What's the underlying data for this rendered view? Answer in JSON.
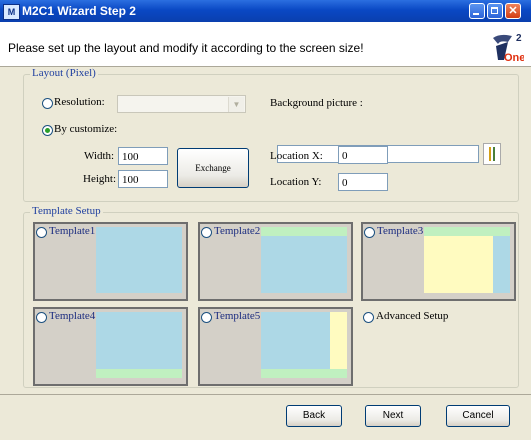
{
  "window": {
    "title": "M2C1 Wizard Step 2",
    "icon_text": "M",
    "close_glyph": "✕"
  },
  "header": {
    "instruction": "Please set up the layout and modify it according to the screen size!",
    "logo_number": "2",
    "logo_text": "One"
  },
  "layout": {
    "legend": "Layout (Pixel)",
    "resolution_label": "Resolution:",
    "resolution_value": "",
    "customize_label": "By customize:",
    "width_label": "Width:",
    "width_value": "100",
    "height_label": "Height:",
    "height_value": "100",
    "exchange_label": "Exchange",
    "background_label": "Background picture :",
    "background_value": "",
    "location_x_label": "Location X:",
    "location_x_value": "0",
    "location_y_label": "Location Y:",
    "location_y_value": "0",
    "selected_mode": "By customize"
  },
  "templates": {
    "legend": "Template Setup",
    "items": [
      {
        "label": "Template1"
      },
      {
        "label": "Template2"
      },
      {
        "label": "Template3"
      },
      {
        "label": "Template4"
      },
      {
        "label": "Template5"
      }
    ],
    "advanced_label": "Advanced Setup"
  },
  "buttons": {
    "back": "Back",
    "next": "Next",
    "cancel": "Cancel"
  },
  "colors": {
    "accent_blue": "#add8e6",
    "accent_green": "#c0f0c0",
    "accent_yellow": "#fffbc0"
  }
}
